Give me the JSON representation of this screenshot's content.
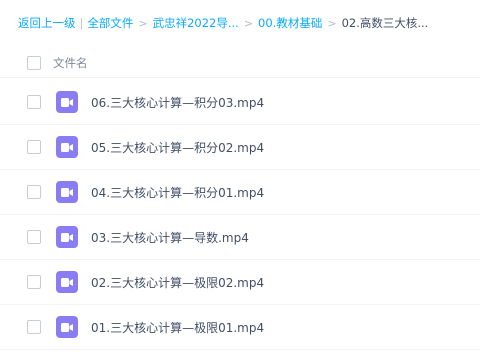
{
  "breadcrumb": {
    "back": "返回上一级",
    "all_files": "全部文件",
    "level1": "武忠祥2022导...",
    "level2": "00.教材基础",
    "current": "02.高数三大核...",
    "pipe": "|",
    "separator": ">"
  },
  "list": {
    "header_label": "文件名",
    "files": [
      {
        "name": "06.三大核心计算—积分03.mp4",
        "icon": "video-file-icon"
      },
      {
        "name": "05.三大核心计算—积分02.mp4",
        "icon": "video-file-icon"
      },
      {
        "name": "04.三大核心计算—积分01.mp4",
        "icon": "video-file-icon"
      },
      {
        "name": "03.三大核心计算—导数.mp4",
        "icon": "video-file-icon"
      },
      {
        "name": "02.三大核心计算—极限02.mp4",
        "icon": "video-file-icon"
      },
      {
        "name": "01.三大核心计算—极限01.mp4",
        "icon": "video-file-icon"
      }
    ]
  },
  "colors": {
    "link": "#09aaff",
    "video_icon": "#8a7df3",
    "text": "#424e67"
  }
}
